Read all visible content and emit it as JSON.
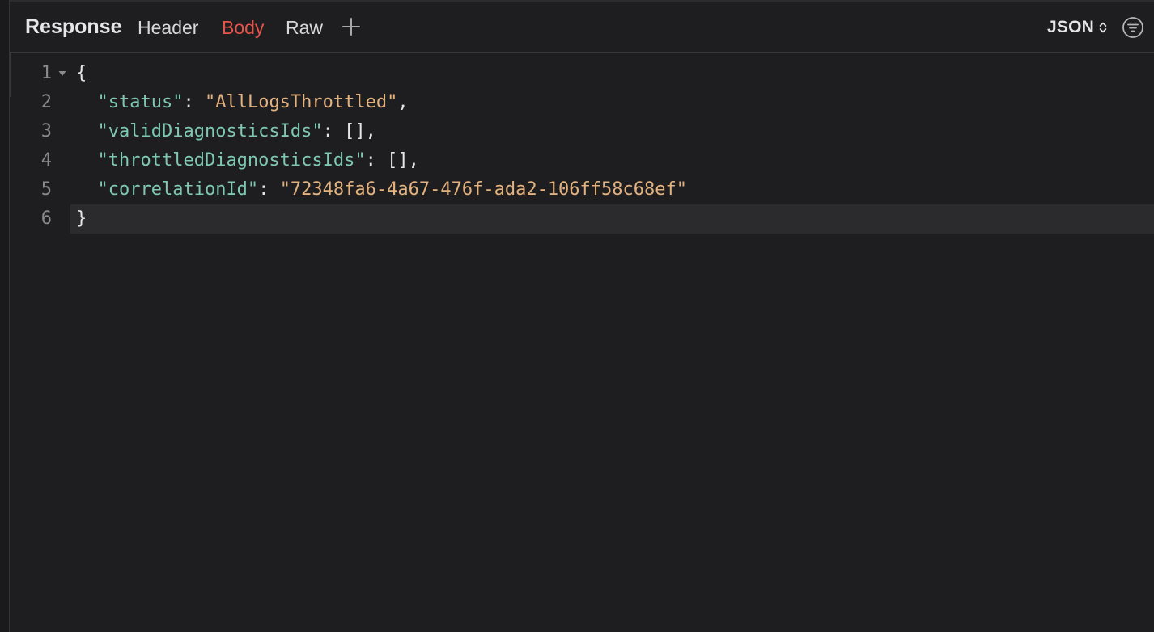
{
  "header": {
    "title": "Response",
    "tabs": {
      "header": "Header",
      "body": "Body",
      "raw": "Raw"
    },
    "active_tab": "Body",
    "format": "JSON"
  },
  "colors": {
    "active_tab": "#e5534b",
    "json_key": "#7fc8b2",
    "json_string": "#e3b27f"
  },
  "editor": {
    "lines": [
      {
        "number": "1",
        "text": "{"
      },
      {
        "number": "2",
        "key": "\"status\"",
        "sep": ": ",
        "value": "\"AllLogsThrottled\"",
        "end": ","
      },
      {
        "number": "3",
        "key": "\"validDiagnosticsIds\"",
        "sep": ": ",
        "value": "[]",
        "end": ","
      },
      {
        "number": "4",
        "key": "\"throttledDiagnosticsIds\"",
        "sep": ": ",
        "value": "[]",
        "end": ","
      },
      {
        "number": "5",
        "key": "\"correlationId\"",
        "sep": ": ",
        "value": "\"72348fa6-4a67-476f-ada2-106ff58c68ef\"",
        "end": ""
      },
      {
        "number": "6",
        "text": "}"
      }
    ]
  }
}
